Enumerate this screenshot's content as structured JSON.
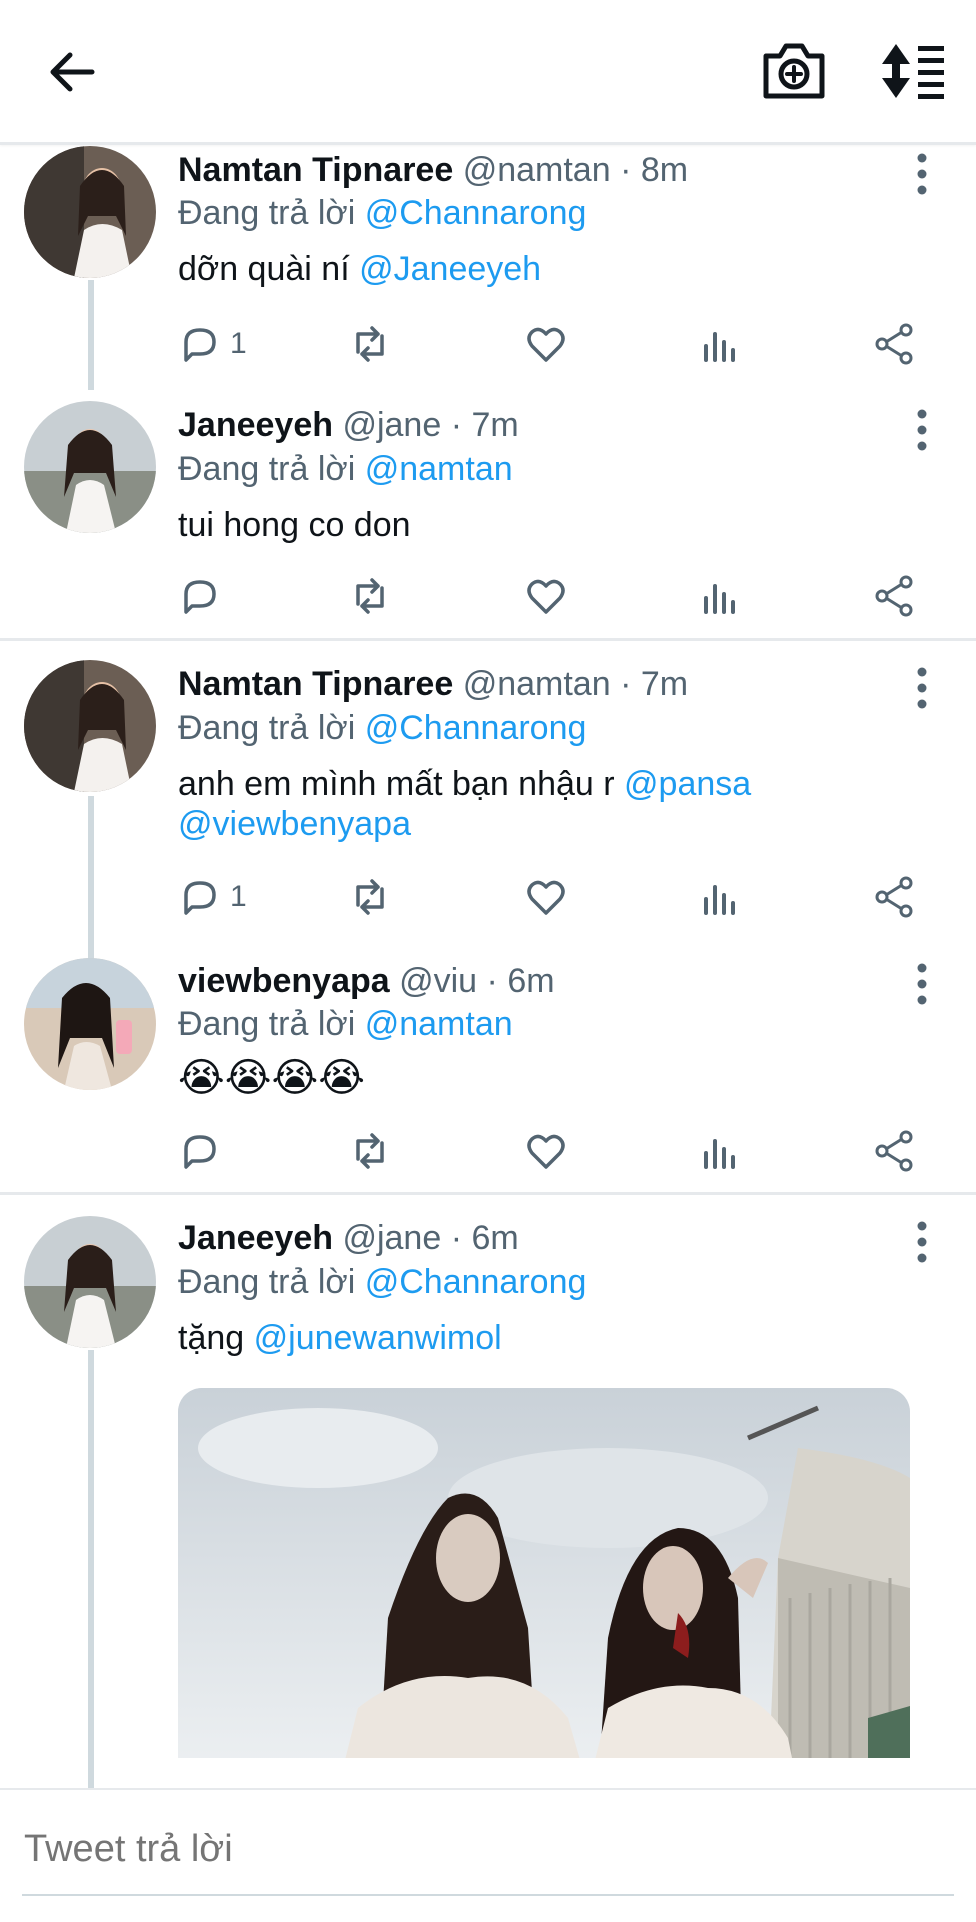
{
  "topbar": {
    "back_icon": "arrow-left-icon",
    "camera_icon": "camera-plus-icon",
    "sort_icon": "sort-list-icon"
  },
  "colors": {
    "accent": "#1d9bf0",
    "secondary_text": "#536471",
    "primary_text": "#0f1419"
  },
  "tweets": [
    {
      "name": "Namtan Tipnaree",
      "handle": "@namtan",
      "dot": "·",
      "time": "8m",
      "reply_prefix": "Đang trả lời",
      "reply_to": "@Channarong",
      "text_before": "dỡn quài ní",
      "text_mention": "@Janeeyeh",
      "reply_count": "1"
    },
    {
      "name": "Janeeyeh",
      "handle": "@jane",
      "dot": "·",
      "time": "7m",
      "reply_prefix": "Đang trả lời",
      "reply_to": "@namtan",
      "text": "tui hong co don",
      "reply_count": ""
    },
    {
      "name": "Namtan Tipnaree",
      "handle": "@namtan",
      "dot": "·",
      "time": "7m",
      "reply_prefix": "Đang trả lời",
      "reply_to": "@Channarong",
      "text_before": "anh em mình mất bạn nhậu r",
      "text_mention_1": "@pansa",
      "text_mention_2": "@viewbenyapa",
      "reply_count": "1"
    },
    {
      "name": "viewbenyapa",
      "handle": "@viu",
      "dot": "·",
      "time": "6m",
      "reply_prefix": "Đang trả lời",
      "reply_to": "@namtan",
      "text": "😭😭😭😭",
      "reply_count": ""
    },
    {
      "name": "Janeeyeh",
      "handle": "@jane",
      "dot": "·",
      "time": "6m",
      "reply_prefix": "Đang trả lời",
      "reply_to": "@Channarong",
      "text_before": "tặng",
      "text_mention": "@junewanwimol",
      "reply_count": ""
    }
  ],
  "composer": {
    "placeholder": "Tweet trả lời"
  }
}
